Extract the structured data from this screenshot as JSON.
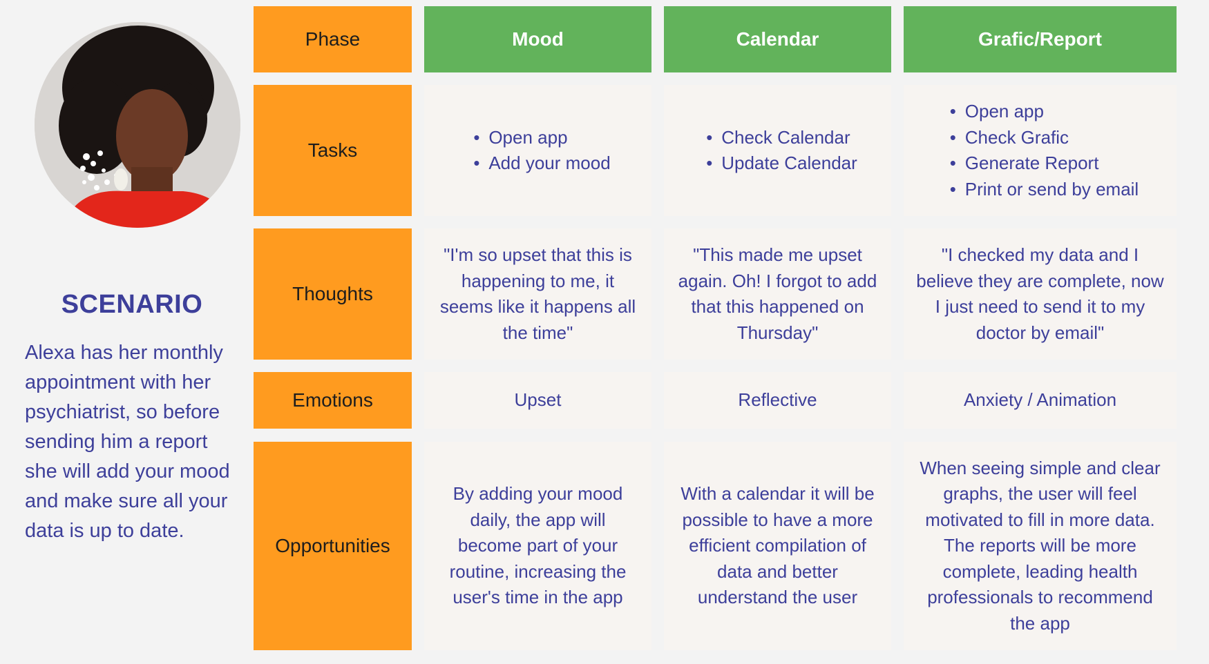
{
  "scenario": {
    "title": "SCENARIO",
    "text": "Alexa has her monthly appointment with her psychiatrist, so before sending him a report she will add your mood and make sure all your data is up to date."
  },
  "header": {
    "phase_label": "Phase",
    "columns": [
      "Mood",
      "Calendar",
      "Grafic/Report"
    ]
  },
  "rows": {
    "tasks": {
      "label": "Tasks",
      "mood": [
        "Open app",
        "Add your mood"
      ],
      "calendar": [
        "Check Calendar",
        "Update Calendar"
      ],
      "report": [
        "Open app",
        "Check Grafic",
        "Generate Report",
        "Print or send by email"
      ]
    },
    "thoughts": {
      "label": "Thoughts",
      "mood": "\"I'm so upset that this is happening to me, it seems like it happens all the time\"",
      "calendar": "\"This made me upset again. Oh! I forgot to add that this happened on Thursday\"",
      "report": "\"I checked my data and I believe they are complete, now I just need to send it to my doctor by email\""
    },
    "emotions": {
      "label": "Emotions",
      "mood": "Upset",
      "calendar": "Reflective",
      "report": "Anxiety / Animation"
    },
    "opportunities": {
      "label": "Opportunities",
      "mood": "By adding your mood daily, the app will become part of your routine, increasing the user's time in the app",
      "calendar": "With a calendar it will be possible to have a more efficient compilation of data and better understand the user",
      "report": "When seeing simple and clear graphs, the user will feel motivated to fill in more data. The reports will be more complete, leading health professionals to recommend the app"
    }
  },
  "colors": {
    "phase": "#ff9b1f",
    "header": "#62b35b",
    "cell": "#f7f4f1",
    "text": "#3d3f9a"
  }
}
